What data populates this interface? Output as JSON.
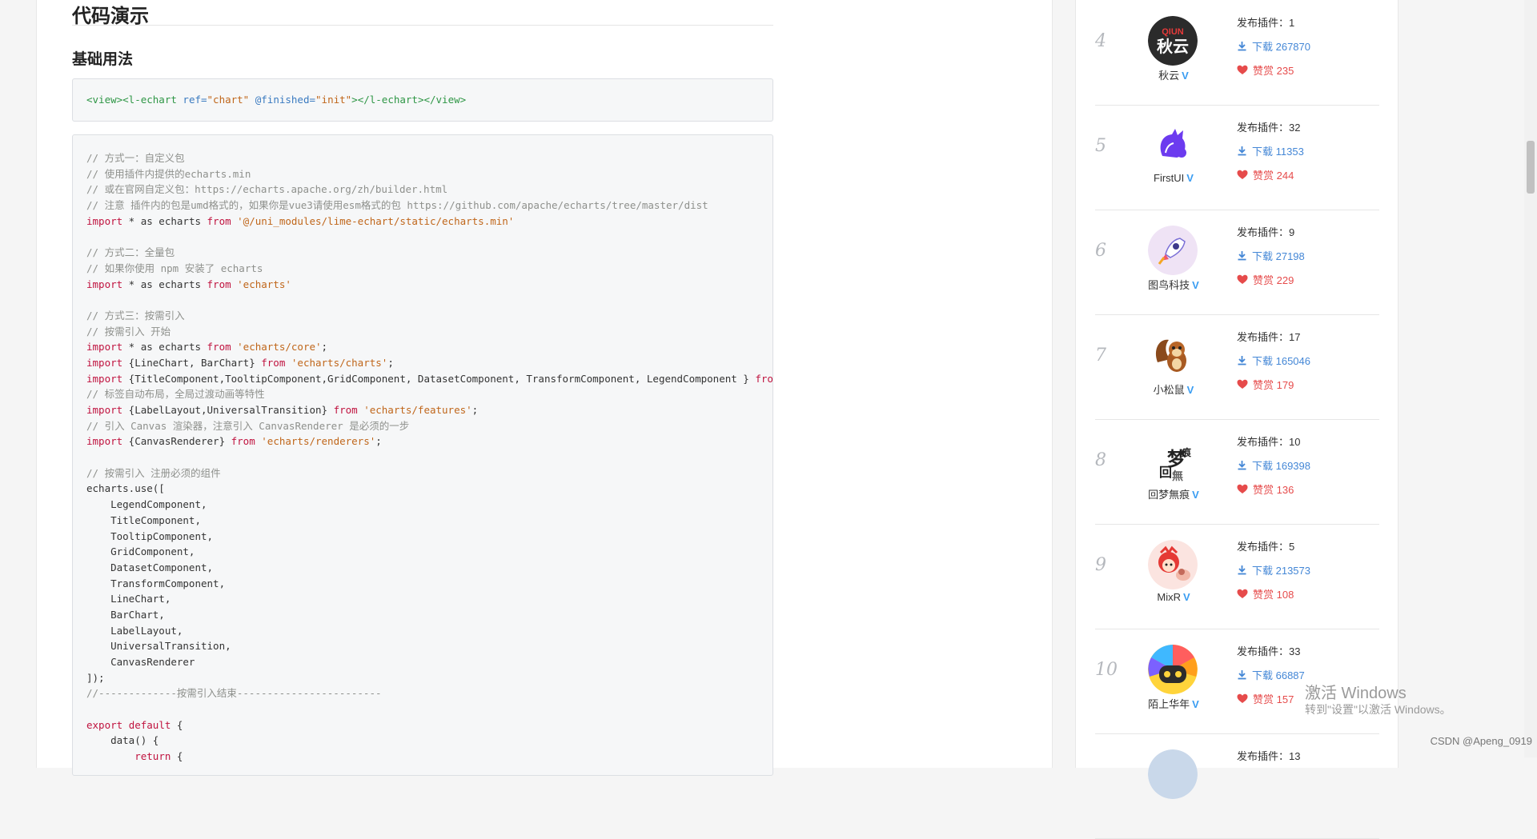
{
  "section": {
    "title": "代码演示",
    "subtitle": "基础用法"
  },
  "template_code": {
    "open_view": "<view>",
    "open_tag": "<l-echart",
    "attr_ref": " ref=",
    "val_ref": "\"chart\"",
    "attr_finished": " @finished=",
    "val_finished": "\"init\"",
    "close": "></l-echart></view>"
  },
  "code_lines": [
    "// 方式一：自定义包",
    "// 使用插件内提供的echarts.min",
    "// 或在官网自定义包：https://echarts.apache.org/zh/builder.html",
    "// 注意 插件内的包是umd格式的，如果你是vue3请使用esm格式的包 https://github.com/apache/echarts/tree/master/dist",
    "import * as echarts from '@/uni_modules/lime-echart/static/echarts.min'",
    "",
    "// 方式二：全量包",
    "// 如果你使用 npm 安装了 echarts",
    "import * as echarts from 'echarts'",
    "",
    "// 方式三：按需引入",
    "// 按需引入 开始",
    "import * as echarts from 'echarts/core';",
    "import {LineChart, BarChart} from 'echarts/charts';",
    "import {TitleComponent,TooltipComponent,GridComponent, DatasetComponent, TransformComponent, LegendComponent } from 'echarts/components';",
    "// 标签自动布局，全局过渡动画等特性",
    "import {LabelLayout,UniversalTransition} from 'echarts/features';",
    "// 引入 Canvas 渲染器，注意引入 CanvasRenderer 是必须的一步",
    "import {CanvasRenderer} from 'echarts/renderers';",
    "",
    "// 按需引入 注册必须的组件",
    "echarts.use([",
    "    LegendComponent,",
    "    TitleComponent,",
    "    TooltipComponent,",
    "    GridComponent,",
    "    DatasetComponent,",
    "    TransformComponent,",
    "    LineChart,",
    "    BarChart,",
    "    LabelLayout,",
    "    UniversalTransition,",
    "    CanvasRenderer",
    "]);",
    "//-------------按需引入结束------------------------",
    "",
    "export default {",
    "    data() {",
    "        return {"
  ],
  "ranking": [
    {
      "rank": "4",
      "author": "秋云",
      "avatar": {
        "icon": "qiun-logo-icon",
        "text": "秋云",
        "bg": "#2b2b2b"
      },
      "publish": "发布插件：1",
      "downloads": "下载 267870",
      "rewards": "赞赏 235"
    },
    {
      "rank": "5",
      "author": "FirstUI",
      "avatar": {
        "icon": "purple-cat-icon",
        "text": "",
        "bg": "#ffffff"
      },
      "publish": "发布插件：32",
      "downloads": "下载 11353",
      "rewards": "赞赏 244"
    },
    {
      "rank": "6",
      "author": "图鸟科技",
      "avatar": {
        "icon": "rocket-icon",
        "text": "",
        "bg": "#f3e4f5"
      },
      "publish": "发布插件：9",
      "downloads": "下载 27198",
      "rewards": "赞赏 229"
    },
    {
      "rank": "7",
      "author": "小松鼠",
      "avatar": {
        "icon": "squirrel-icon",
        "text": "",
        "bg": "#ffffff"
      },
      "publish": "发布插件：17",
      "downloads": "下载 165046",
      "rewards": "赞赏 179"
    },
    {
      "rank": "8",
      "author": "回梦無痕",
      "avatar": {
        "icon": "calligraphy-icon",
        "text": "梦",
        "bg": "#ffffff"
      },
      "publish": "发布插件：10",
      "downloads": "下载 169398",
      "rewards": "赞赏 136"
    },
    {
      "rank": "9",
      "author": "MixR",
      "avatar": {
        "icon": "red-cartoon-icon",
        "text": "",
        "bg": "#fbe4e0"
      },
      "publish": "发布插件：5",
      "downloads": "下载 213573",
      "rewards": "赞赏 108"
    },
    {
      "rank": "10",
      "author": "陌上华年",
      "avatar": {
        "icon": "rainbow-robot-icon",
        "text": "",
        "bg": "#ffd43b"
      },
      "publish": "发布插件：33",
      "downloads": "下载 66887",
      "rewards": "赞赏 157"
    },
    {
      "rank": "",
      "author": "",
      "avatar": {
        "icon": "partial-avatar-icon",
        "text": "",
        "bg": "#c9d8ea"
      },
      "publish": "发布插件：13",
      "downloads": "",
      "rewards": ""
    }
  ],
  "watermark": {
    "title": "激活 Windows",
    "subtitle": "转到\"设置\"以激活 Windows。"
  },
  "footer": {
    "csdn": "CSDN @Apeng_0919"
  },
  "colors": {
    "download": "#4487d6",
    "reward": "#e64b4b",
    "verified": "#3a9df2",
    "rank": "#b5b8bd"
  }
}
